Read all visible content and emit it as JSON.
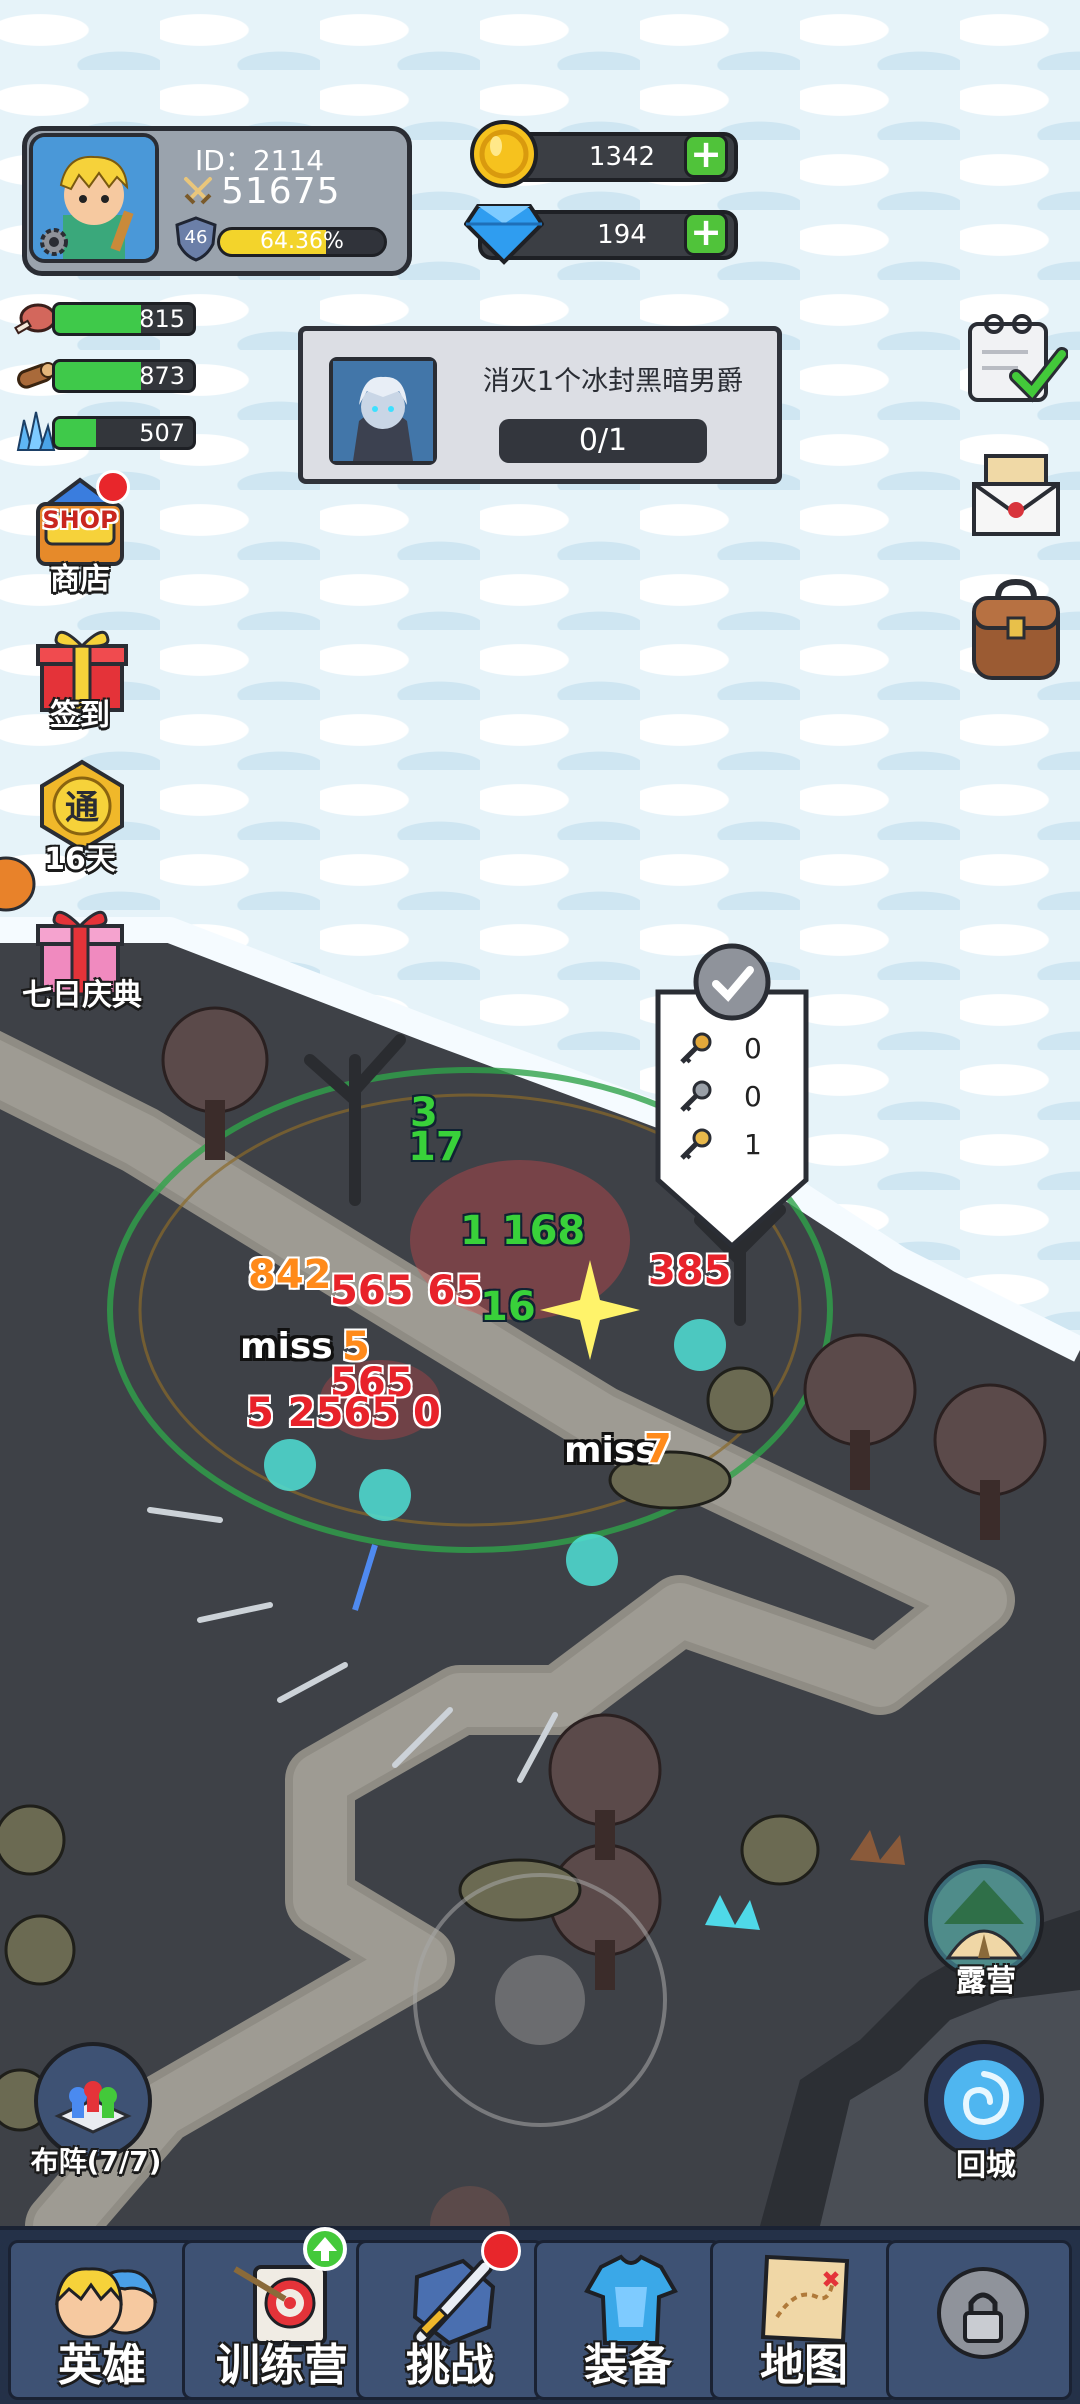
{
  "player": {
    "id_text": "ID：2114",
    "power": "51675",
    "level": "46",
    "exp_text": "64.36%",
    "exp_fraction": 0.6436
  },
  "currency": {
    "gold": "1342",
    "diamond": "194"
  },
  "resources": [
    {
      "name": "meat",
      "value": "815",
      "fill": 0.62
    },
    {
      "name": "wood",
      "value": "873",
      "fill": 0.62
    },
    {
      "name": "crystal",
      "value": "507",
      "fill": 0.3
    }
  ],
  "quest": {
    "title": "消灭1个冰封黑暗男爵",
    "progress": "0/1"
  },
  "left_menu": {
    "shop_badge": "SHOP",
    "shop": "商店",
    "checkin": "签到",
    "pass_badge": "通",
    "pass_days": "16天",
    "seven_day": "七日庆典"
  },
  "keys": {
    "gold_key": "0",
    "silver_key": "0",
    "bronze_key": "1"
  },
  "combat_text": {
    "miss1": "miss",
    "miss2": "miss",
    "red1": "842",
    "red2": "565 65",
    "red3": "385",
    "red4": "565",
    "red5": "5 2565 0",
    "green1": "17",
    "green2": "16",
    "green3": "3",
    "green4": "1 168",
    "orange1": "7",
    "orange2": "5"
  },
  "right_menu": {
    "camp": "露营",
    "return_city": "回城"
  },
  "formation": "布阵(7/7)",
  "nav": {
    "hero": "英雄",
    "training": "训练营",
    "challenge": "挑战",
    "equipment": "装备",
    "map": "地图"
  },
  "colors": {
    "exp_bar": "#f3d42b",
    "resource_bar": "#3fc94a",
    "plus_button": "#50c33a",
    "nav_bg": "#243148",
    "badge_red": "#e8262b"
  }
}
